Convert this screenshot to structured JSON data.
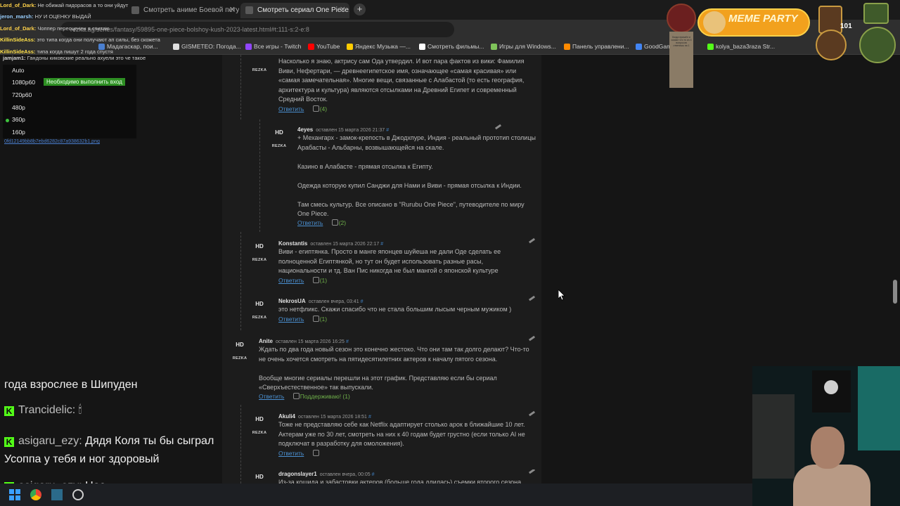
{
  "browser": {
    "tabs": [
      {
        "label": "Смотреть аниме Боевой петух",
        "active": false
      },
      {
        "label": "Смотреть сериал One Piece. Б",
        "active": true
      }
    ],
    "url": "rezka.ag/series/fantasy/59895-one-piece-bolshoy-kush-2023-latest.html#t:111-s:2-e:8",
    "bookmarks": [
      {
        "label": "Мадагаскар, пои...",
        "color": "#4a7fd0"
      },
      {
        "label": "GISMETEO: Погода...",
        "color": "#e0e0e0"
      },
      {
        "label": "Все игры - Twitch",
        "color": "#9146ff"
      },
      {
        "label": "YouTube",
        "color": "#ff0000"
      },
      {
        "label": "Яндекс Музыка —...",
        "color": "#ffcc00"
      },
      {
        "label": "Смотреть фильмы...",
        "color": "#ffffff"
      },
      {
        "label": "Игры для Windows...",
        "color": "#7fc45a"
      },
      {
        "label": "Панель управлени...",
        "color": "#ff8a00"
      },
      {
        "label": "GoodGam",
        "color": "#4285f4"
      },
      {
        "label": "kolya_baza3raza Str...",
        "color": "#53fc18"
      }
    ]
  },
  "chat_top": [
    {
      "nick": "Lord_of_Dark:",
      "text": "Не обижай пидорасов а то они уйдут",
      "color": "#ffd24a"
    },
    {
      "nick": "jeron_marsh:",
      "text": "НУ И ОЦЕНКУ ВЫДАЙ",
      "color": "#9ad0ff"
    },
    {
      "nick": "Lord_of_Dark:",
      "text": "Чоппер переоценен я считаю",
      "color": "#ffd24a"
    },
    {
      "nick": "KillinSideAss:",
      "text": "это типа когда они получают ап силы, без скожета",
      "color": "#ffe14a"
    },
    {
      "nick": "KillinSideAss:",
      "text": "типа когда пишут 2 года спустя",
      "color": "#ffe14a"
    },
    {
      "nick": "jamjam1:",
      "text": "Гандоны киковские реально ахуели это че такое",
      "color": "#d0d0d0"
    }
  ],
  "quality_menu": {
    "items": [
      "Auto",
      "1080p60",
      "720p60",
      "480p",
      "360p",
      "160p"
    ],
    "selected": "360p",
    "notice": "Необходимо выполнить вход",
    "file_link": "0fd12149bb8b7ebd6282c87a938632b1.png"
  },
  "comments": [
    {
      "id": "c0",
      "author": "",
      "meta": "",
      "body": "Насколько я знаю, актрису сам Ода утвердил. И вот пара фактов из вики: Фамилия Виви, Нефертари, — древнеегипетское имя, означающее «самая красивая» или «самая замечательная». Многие вещи, связанные с Алабастой (то есть география, архитектура и культура) являются отсылками на Древний Египет и современный Средний Восток.",
      "reply": "Ответить",
      "likes": "(4)"
    },
    {
      "id": "c1",
      "author": "4eyes",
      "meta": "оставлен 15 марта 2026 21:37",
      "body": "+ Механгарх - замок-крепость в Джодхпуре, Индия - реальный прототип столицы Арабасты - Альбарны, возвышающейся на скале.\n\nКазино в Алабасте - прямая отсылка к Египту.\n\nОдежда которую купил Санджи для Нами и Виви - прямая отсылка к Индии.\n\nТам смесь культур. Все описано в \"Rurubu One Piece\", путеводителе по миру One Piece.",
      "reply": "Ответить",
      "likes": "(2)"
    },
    {
      "id": "c2",
      "author": "Konstantis",
      "meta": "оставлен 15 марта 2026 22:17",
      "body": "Виви - египтянка. Просто в манге японцев шуйеша не дали Оде сделать ее полноценной Египтянкой, но тут он будет использовать разные расы, национальности и тд. Ван Пис никогда не был мангой о японской культуре",
      "reply": "Ответить",
      "likes": "(1)"
    },
    {
      "id": "c3",
      "author": "NekrosUA",
      "meta": "оставлен вчера, 03:41",
      "body": "это нетфликс. Скажи спасибо что не стала большим лысым черным мужиком )",
      "reply": "Ответить",
      "likes": "(1)"
    },
    {
      "id": "c4",
      "author": "Anite",
      "meta": "оставлен 15 марта 2026 16:25",
      "body": "Ждать по два года новый сезон это конечно жестоко. Что они там так долго делают? Что-то не очень хочется смотреть на пятидесятилетних актеров к началу пятого сезона.\n\nВообще многие сериалы перешли на этот график. Представляю если бы сериал «Сверхъестественное» так выпускали.",
      "reply": "Ответить",
      "likes": "Поддерживаю! (1)"
    },
    {
      "id": "c5",
      "author": "Akuli4",
      "meta": "оставлен 15 марта 2026 18:51",
      "body": "Тоже не представляю себе как Netflix адаптирует столько арок в ближайшие 10 лет. Актерам уже по 30 лет, смотреть на них к 40 годам будет грустно (если только AI не подключат в разработку для омоложения).",
      "reply": "Ответить",
      "likes": ""
    },
    {
      "id": "c6",
      "author": "dragonslayer1",
      "meta": "оставлен вчера, 00:05",
      "body": "Из-за кошида и забастовки актеров (больше года длилась) съемки второго сезона",
      "reply": "",
      "likes": ""
    }
  ],
  "badges": {
    "hd": "HD",
    "rezka": "REZKA",
    "hash": "#"
  },
  "chat_bottom": [
    {
      "nick": "",
      "text": "года взрослее в Шипуден",
      "logo": false
    },
    {
      "nick": "Trancidelic:",
      "text": "🕯",
      "logo": true
    },
    {
      "nick": "asigaru_ezy:",
      "text": "Дядя Коля ты бы сыграл",
      "logo": true
    },
    {
      "nick": "",
      "text": "Усоппа у тебя и ног здоровый",
      "logo": false
    },
    {
      "nick": "asigaru_ezy:",
      "text": "Нос",
      "logo": true
    }
  ],
  "overlay": {
    "meme_party": "MEME PARTY",
    "counter": "101",
    "scroll_text": "Когда пришёл и сказал что то из 4 вопросов ответишь на 1"
  },
  "colors": {
    "link": "#4a8fd0",
    "like": "#6fb04a",
    "kick": "#53fc18"
  }
}
